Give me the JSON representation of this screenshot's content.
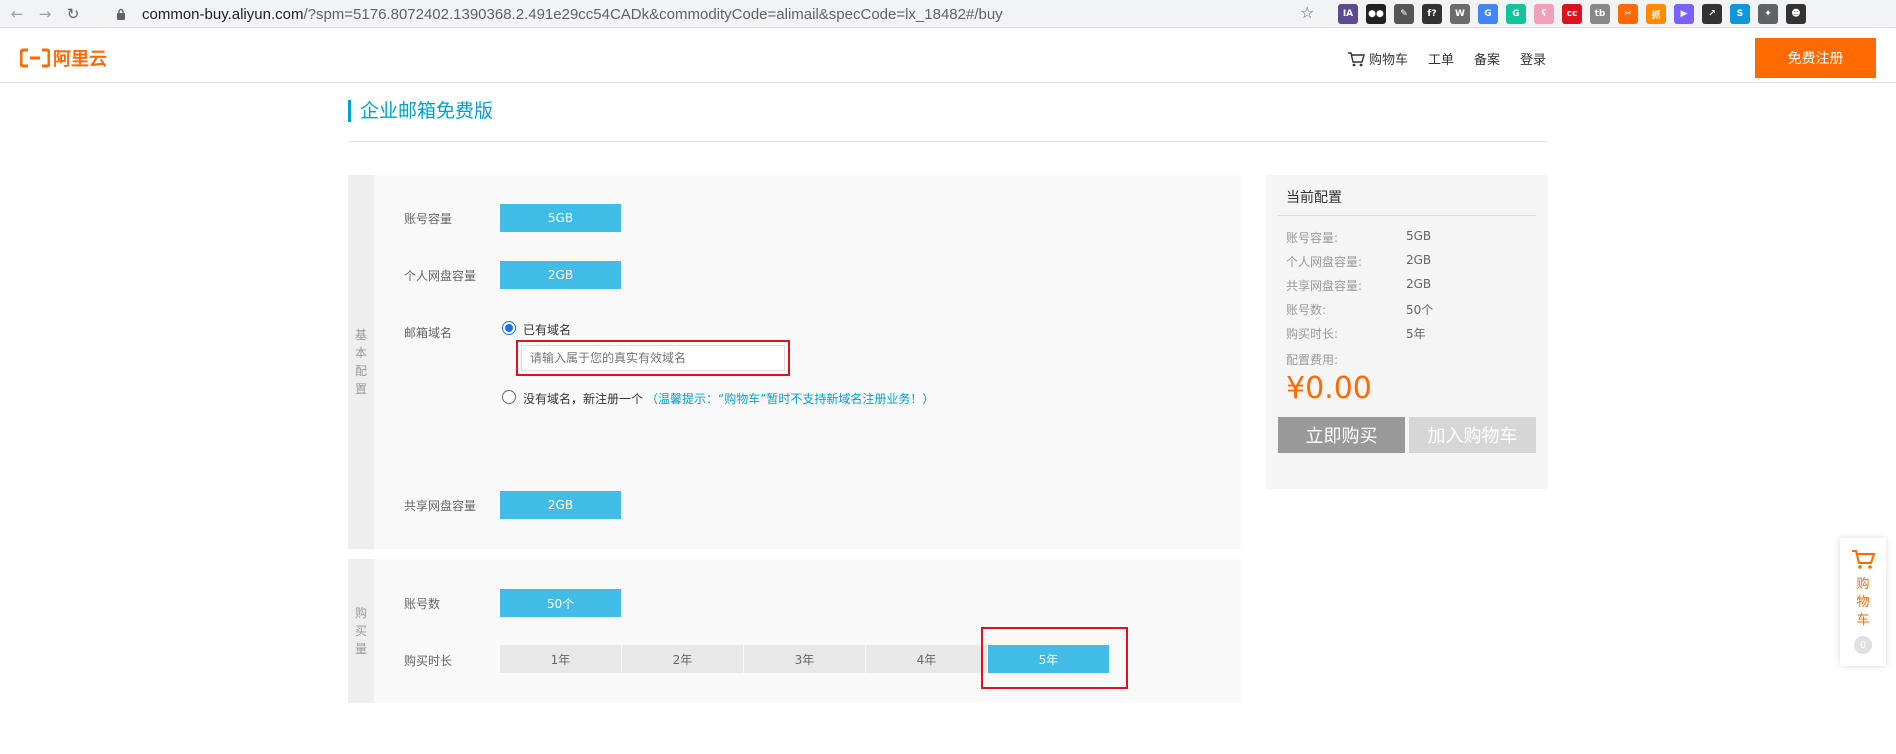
{
  "browser": {
    "url_host": "common-buy.aliyun.com",
    "url_path": "/?spm=5176.8072402.1390368.2.491e29cc54CADk&commodityCode=alimail&specCode=lx_18482#/buy",
    "extensions": [
      {
        "name": "ia-extension-icon",
        "label": "IA",
        "color": "#5b4a8f"
      },
      {
        "name": "tampermonkey-icon",
        "label": "●●",
        "color": "#222222"
      },
      {
        "name": "eyedropper-icon",
        "label": "✎",
        "color": "#555555"
      },
      {
        "name": "whatfont-icon",
        "label": "f?",
        "color": "#333333"
      },
      {
        "name": "wordpress-icon",
        "label": "W",
        "color": "#6b6b6b"
      },
      {
        "name": "translate-icon",
        "label": "G",
        "color": "#4285f4"
      },
      {
        "name": "grammarly-icon",
        "label": "G",
        "color": "#15c39a"
      },
      {
        "name": "bilibili-icon",
        "label": "ʕ",
        "color": "#f0a0b8"
      },
      {
        "name": "cc-icon",
        "label": "cc",
        "color": "#d9141e"
      },
      {
        "name": "tb-icon",
        "label": "tb",
        "color": "#888888"
      },
      {
        "name": "tools-icon",
        "label": "✂",
        "color": "#ff6a00"
      },
      {
        "name": "grab-icon",
        "label": "抓",
        "color": "#ff8a00"
      },
      {
        "name": "screen-icon",
        "label": "▶",
        "color": "#7b61ff"
      },
      {
        "name": "arrow-icon",
        "label": "↗",
        "color": "#333333"
      },
      {
        "name": "s-icon",
        "label": "S",
        "color": "#1296db"
      },
      {
        "name": "puzzle-icon",
        "label": "✦",
        "color": "#5f6368"
      },
      {
        "name": "profile-icon",
        "label": "☻",
        "color": "#333333"
      }
    ]
  },
  "header": {
    "logo_text": "阿里云",
    "cart": "购物车",
    "ticket": "工单",
    "filing": "备案",
    "login": "登录",
    "register": "免费注册"
  },
  "page": {
    "title": "企业邮箱免费版"
  },
  "basic_config": {
    "section_label": "基本配置",
    "capacity_label": "账号容量",
    "capacity_value": "5GB",
    "personal_disk_label": "个人网盘容量",
    "personal_disk_value": "2GB",
    "domain_label": "邮箱域名",
    "has_domain": "已有域名",
    "domain_placeholder": "请输入属于您的真实有效域名",
    "no_domain": "没有域名，新注册一个",
    "hint": "（温馨提示：“购物车”暂时不支持新域名注册业务！）",
    "shared_disk_label": "共享网盘容量",
    "shared_disk_value": "2GB"
  },
  "purchase": {
    "section_label": "购买量",
    "accounts_label": "账号数",
    "accounts_value": "50个",
    "duration_label": "购买时长",
    "durations": [
      "1年",
      "2年",
      "3年",
      "4年",
      "5年"
    ],
    "selected_duration_index": 4
  },
  "summary": {
    "title": "当前配置",
    "rows": [
      {
        "label": "账号容量:",
        "value": "5GB"
      },
      {
        "label": "个人网盘容量:",
        "value": "2GB"
      },
      {
        "label": "共享网盘容量:",
        "value": "2GB"
      },
      {
        "label": "账号数:",
        "value": "50个"
      },
      {
        "label": "购买时长:",
        "value": "5年"
      }
    ],
    "fee_label": "配置费用:",
    "price": "¥0.00",
    "buy_now": "立即购买",
    "add_to_cart": "加入购物车"
  },
  "float_cart": {
    "label": "购物车",
    "count": "0"
  },
  "colors": {
    "brand": "#ff6a00",
    "accent": "#40bce6",
    "title": "#00a2ca",
    "highlight": "#d9141e"
  }
}
